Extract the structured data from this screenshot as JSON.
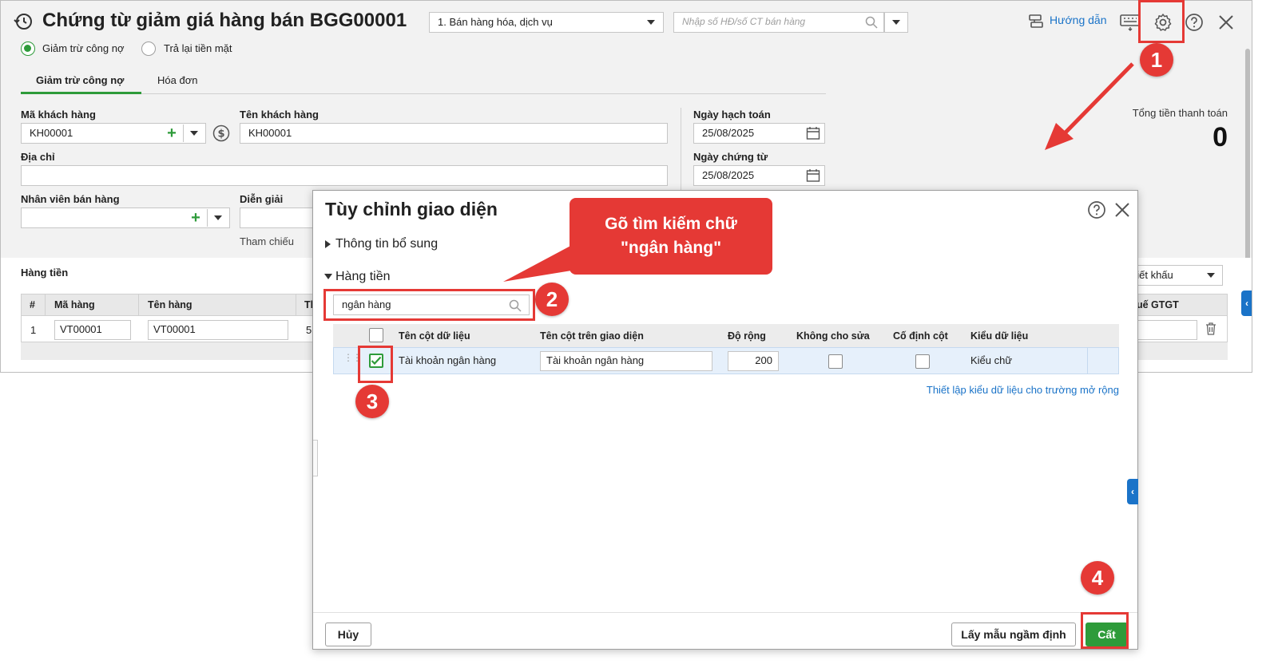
{
  "window": {
    "title": "Chứng từ giảm giá hàng bán BGG00001",
    "type_select": "1. Bán hàng hóa, dịch vụ",
    "invoice_search_placeholder": "Nhập số HĐ/số CT bán hàng",
    "guide_label": "Hướng dẫn"
  },
  "mode": {
    "option1": "Giảm trừ công nợ",
    "option2": "Trả lại tiền mặt"
  },
  "tabs": {
    "tab1": "Giảm trừ công nợ",
    "tab2": "Hóa đơn"
  },
  "form": {
    "customer_code_label": "Mã khách hàng",
    "customer_code_value": "KH00001",
    "customer_name_label": "Tên khách hàng",
    "customer_name_value": "KH00001",
    "address_label": "Địa chỉ",
    "sales_staff_label": "Nhân viên bán hàng",
    "description_label": "Diễn giải",
    "reference_label": "Tham chiếu",
    "posting_date_label": "Ngày hạch toán",
    "posting_date_value": "25/08/2025",
    "doc_date_label": "Ngày chứng từ",
    "doc_date_value": "25/08/2025",
    "total_label": "Tổng tiền thanh toán",
    "total_value": "0"
  },
  "goods": {
    "section_label": "Hàng tiền",
    "discount_select": "hiết khấu",
    "col_no": "#",
    "col_code": "Mã hàng",
    "col_name": "Tên hàng",
    "col_partial": "Th",
    "col_vat": "uế GTGT",
    "row_no": "1",
    "row_code": "VT00001",
    "row_name": "VT00001",
    "row_partial": "5"
  },
  "modal": {
    "title": "Tùy chỉnh giao diện",
    "section_extra": "Thông tin bổ sung",
    "section_goods": "Hàng tiền",
    "search_value": "ngân hàng",
    "col_data": "Tên cột dữ liệu",
    "col_display": "Tên cột trên giao diện",
    "col_width": "Độ rộng",
    "col_readonly": "Không cho sửa",
    "col_fixed": "Cố định cột",
    "col_type": "Kiểu dữ liệu",
    "row_data": "Tài khoản ngân hàng",
    "row_display": "Tài khoản ngân hàng",
    "row_width": "200",
    "row_type": "Kiểu chữ",
    "link_setup": "Thiết lập kiểu dữ liệu cho trường mở rộng",
    "cancel_label": "Hủy",
    "default_label": "Lấy mẫu ngầm định",
    "save_label": "Cất"
  },
  "callout": {
    "text": "Gõ tìm kiếm chữ \"ngân hàng\""
  },
  "steps": {
    "s1": "1",
    "s2": "2",
    "s3": "3",
    "s4": "4"
  },
  "colors": {
    "accent_green": "#2e9b3a",
    "annotation_red": "#e53935",
    "link_blue": "#1a73c8"
  }
}
